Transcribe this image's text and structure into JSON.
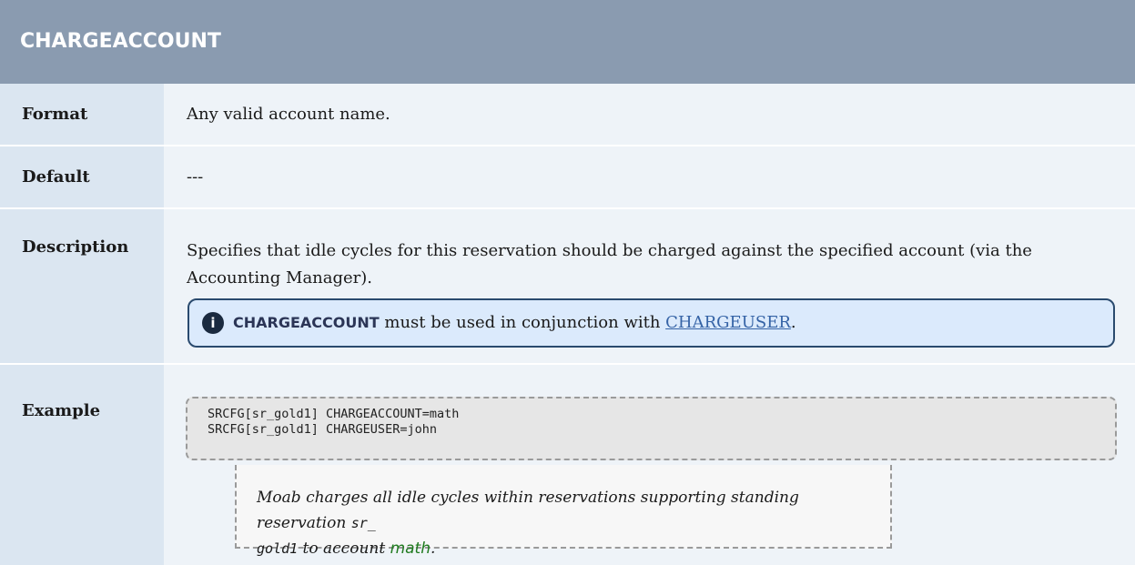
{
  "title": "CHARGEACCOUNT",
  "rows": {
    "format": {
      "label": "Format",
      "value": "Any valid account name."
    },
    "default": {
      "label": "Default",
      "value": "---"
    },
    "description": {
      "label": "Description",
      "text": "Specifies that idle cycles for this reservation should be charged against the specified account (via the Accounting Manager).",
      "note": {
        "icon": "info-icon",
        "icon_glyph": "i",
        "keyword": "CHARGEACCOUNT",
        "middle": " must be used in conjunction with ",
        "link": "CHARGEUSER",
        "end": "."
      }
    },
    "example": {
      "label": "Example",
      "code_lines": [
        "SRCFG[sr_gold1] CHARGEACCOUNT=math",
        "SRCFG[sr_gold1] CHARGEUSER=john"
      ],
      "caption": {
        "part1": "Moab charges all idle cycles within reservations supporting standing reservation ",
        "mono1": "sr_",
        "mono2": "gold1",
        "part2": " to account ",
        "green": "math",
        "end": "."
      }
    }
  },
  "colors": {
    "header_bg": "#8a9bb0",
    "label_bg": "#dbe6f1",
    "value_bg": "#eef3f8",
    "note_bg": "#dbeafc",
    "link": "#3563a6",
    "green": "#1f7a1f"
  }
}
